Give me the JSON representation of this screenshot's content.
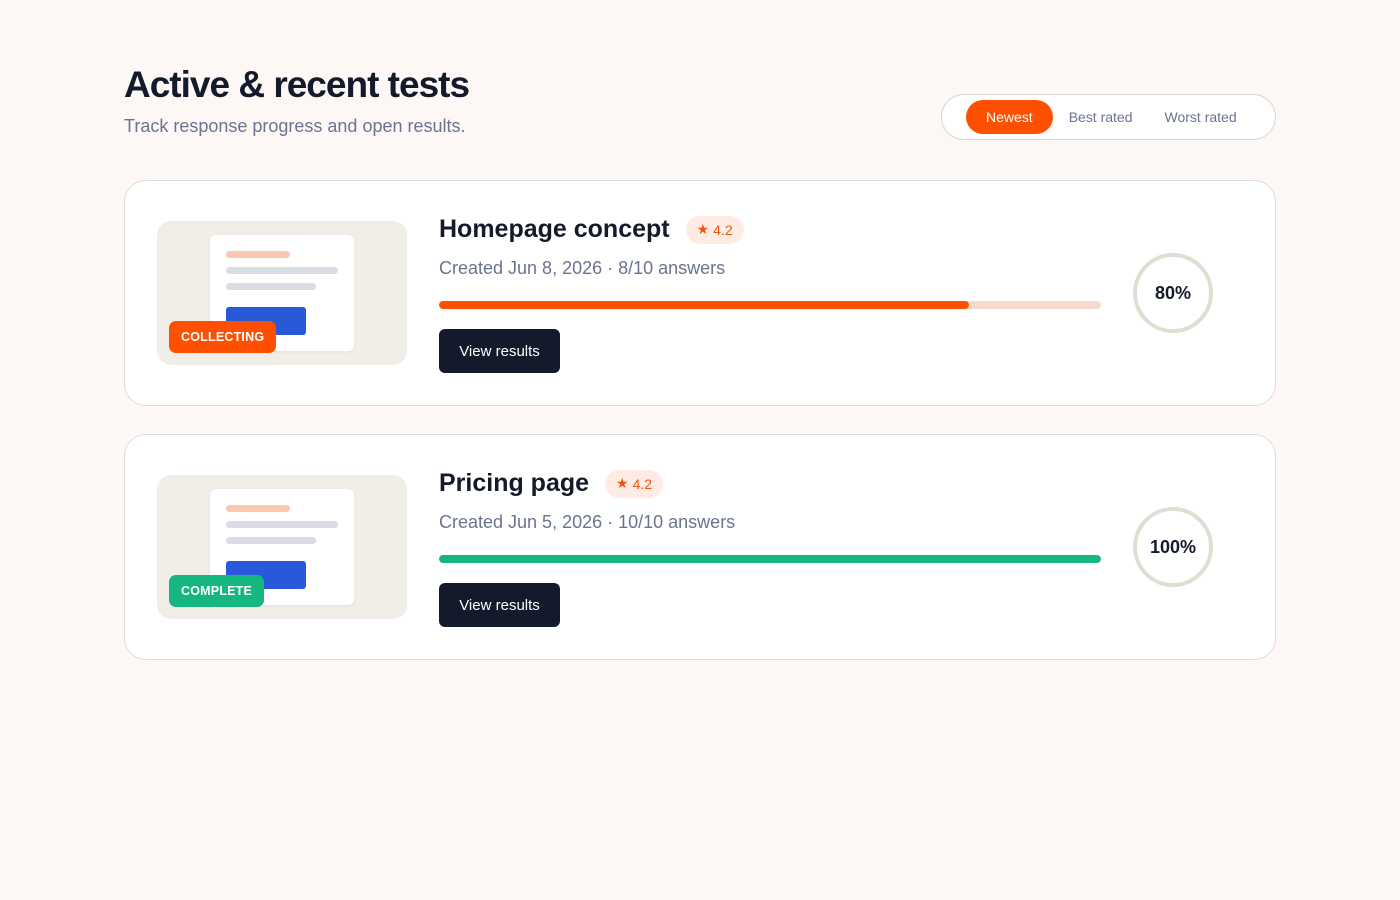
{
  "header": {
    "title": "Active & recent tests",
    "subtitle": "Track response progress and open results."
  },
  "sort": {
    "options": [
      "Newest",
      "Best rated",
      "Worst rated"
    ],
    "selected": "Newest"
  },
  "colors": {
    "accent": "#ff4f00",
    "collecting": "#ff4f00",
    "complete": "#16b67f",
    "dark": "#131a2b"
  },
  "tests": [
    {
      "title": "Homepage concept",
      "rating": "4.2",
      "meta": "Created Jun 8, 2026 · 8/10 answers",
      "status": "COLLECTING",
      "status_color": "#ff4f00",
      "progress": 0.8,
      "progress_color": "#ff4f00",
      "percent_label": "80%",
      "button_label": "View results",
      "rating_icon": "star-icon"
    },
    {
      "title": "Pricing page",
      "rating": "4.2",
      "meta": "Created Jun 5, 2026 · 10/10 answers",
      "status": "COMPLETE",
      "status_color": "#16b67f",
      "progress": 1.0,
      "progress_color": "#16b67f",
      "percent_label": "100%",
      "button_label": "View results",
      "rating_icon": "star-icon"
    }
  ]
}
